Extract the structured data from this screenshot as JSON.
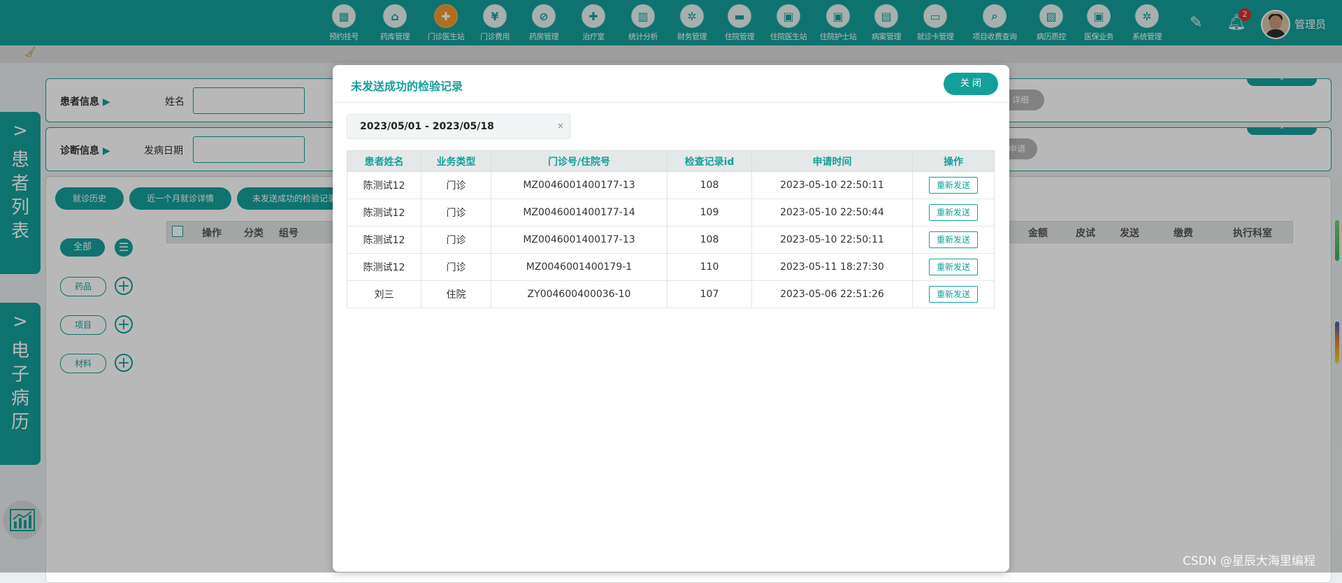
{
  "header": {
    "nav_items": [
      {
        "label": "预约挂号",
        "icon": "calendar-icon",
        "glyph": "▦"
      },
      {
        "label": "药库管理",
        "icon": "pill-warehouse-icon",
        "glyph": "⌂"
      },
      {
        "label": "门诊医生站",
        "icon": "doctor-icon",
        "glyph": "✚",
        "active": true
      },
      {
        "label": "门诊费用",
        "icon": "yen-icon",
        "glyph": "¥"
      },
      {
        "label": "药房管理",
        "icon": "capsule-icon",
        "glyph": "⊘"
      },
      {
        "label": "治疗室",
        "icon": "nurse-icon",
        "glyph": "✚"
      },
      {
        "label": "统计分析",
        "icon": "bar-chart-icon",
        "glyph": "▥"
      },
      {
        "label": "财务管理",
        "icon": "gear-money-icon",
        "glyph": "✲"
      },
      {
        "label": "住院管理",
        "icon": "hospital-bed-icon",
        "glyph": "▬"
      },
      {
        "label": "住院医生站",
        "icon": "doctor-card-icon",
        "glyph": "▣"
      },
      {
        "label": "住院护士站",
        "icon": "nurse-card-icon",
        "glyph": "▣"
      },
      {
        "label": "病案管理",
        "icon": "record-file-icon",
        "glyph": "▤"
      },
      {
        "label": "就诊卡管理",
        "icon": "id-card-icon",
        "glyph": "▭"
      },
      {
        "label": "项目收费查询",
        "icon": "search-document-icon",
        "glyph": "⌕"
      },
      {
        "label": "病历质控",
        "icon": "clipboard-icon",
        "glyph": "▧"
      },
      {
        "label": "医保业务",
        "icon": "insurance-card-icon",
        "glyph": "▣"
      },
      {
        "label": "系统管理",
        "icon": "settings-icon",
        "glyph": "✲"
      }
    ],
    "notification_count": "2",
    "username": "管理员"
  },
  "sidebar": {
    "patient_list_tab": "患者列表",
    "emr_tab": "电子病历"
  },
  "patient_panel": {
    "title": "患者信息",
    "name_label": "姓名",
    "details_button": "详细"
  },
  "diagnosis_panel": {
    "title": "诊断信息",
    "onset_label": "发病日期",
    "apply_button": "申请"
  },
  "main_panel": {
    "buttons": [
      "就诊历史",
      "近一个月就诊详情",
      "未发送成功的检验记录"
    ],
    "filters": [
      "全部",
      "药品",
      "项目",
      "材料"
    ],
    "table_headers_left": [
      "操作",
      "分类",
      "组号"
    ],
    "table_headers_right": [
      "金额",
      "皮试",
      "发送",
      "缴费",
      "执行科室"
    ]
  },
  "modal": {
    "title": "未发送成功的检验记录",
    "close_label": "关 闭",
    "date_range": "2023/05/01 - 2023/05/18",
    "date_clear": "×",
    "columns": [
      "患者姓名",
      "业务类型",
      "门诊号/住院号",
      "检查记录id",
      "申请时间",
      "操作"
    ],
    "rows": [
      {
        "name": "陈测试12",
        "type": "门诊",
        "number": "MZ0046001400177-13",
        "record_id": "108",
        "time": "2023-05-10 22:50:11",
        "action": "重新发送"
      },
      {
        "name": "陈测试12",
        "type": "门诊",
        "number": "MZ0046001400177-14",
        "record_id": "109",
        "time": "2023-05-10 22:50:44",
        "action": "重新发送"
      },
      {
        "name": "陈测试12",
        "type": "门诊",
        "number": "MZ0046001400177-13",
        "record_id": "108",
        "time": "2023-05-10 22:50:11",
        "action": "重新发送"
      },
      {
        "name": "陈测试12",
        "type": "门诊",
        "number": "MZ0046001400179-1",
        "record_id": "110",
        "time": "2023-05-11 18:27:30",
        "action": "重新发送"
      },
      {
        "name": "刘三",
        "type": "住院",
        "number": "ZY004600400036-10",
        "record_id": "107",
        "time": "2023-05-06 22:51:26",
        "action": "重新发送"
      }
    ]
  },
  "watermark": "CSDN @星辰大海里编程",
  "colors": {
    "brand": "#14a09a",
    "active_nav": "#f39a2e",
    "badge": "#e12d2d"
  }
}
